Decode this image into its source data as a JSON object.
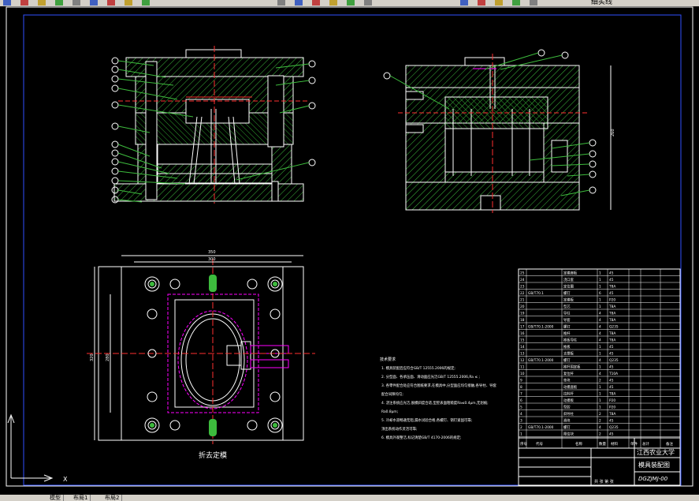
{
  "toolbar": {
    "layer_label": "细实线",
    "icons": [
      "open-icon",
      "save-icon",
      "print-icon",
      "preview-icon",
      "plot-icon",
      "cut-icon",
      "copy-icon",
      "paste-icon",
      "match-icon",
      "undo-icon",
      "redo-icon",
      "pan-icon",
      "zoom-realtime-icon",
      "zoom-window-icon",
      "zoom-previous-icon",
      "properties-icon",
      "design-center-icon",
      "tool-palette-icon",
      "layer-icon",
      "color-icon"
    ]
  },
  "statusbar": {
    "tabs": [
      "模型",
      "布局1",
      "布局2"
    ]
  },
  "drawing": {
    "view_label": "折去定模",
    "notes_title": "技术要求",
    "notes": [
      "1. 模具装配后应符合GB/T 12555.2006的规定;",
      "2. 分型面、各承压面、滑动面应光洁GB/T 12555.2006,Ra ≤ ;",
      "3. 各零件配合处应符合图纸要求,在模具中,分型面应均匀接触,各导柱、导套",
      "   配合间隙均匀;",
      "4. 浇注系统应光洁,脱模斜度合适,型腔表面粗糙度Ra≤0.4μm,无划痕;",
      "   Ra0.8μm;",
      "5. 冷却水道畅通无阻,漏水试验合格,各螺钉、销钉紧固可靠;",
      "   顶出系统动作灵活可靠;",
      "6. 模具外观整洁,标记清楚GB/T 4170-2006的规定;"
    ],
    "title_block": {
      "school": "江西农业大学",
      "drawing_name": "模具装配图",
      "drawing_no": "DGZJMJ-00",
      "sheet": "共 张 第 张"
    },
    "bom_header": [
      "序号",
      "代号",
      "名称",
      "数量",
      "材料",
      "单件",
      "总计",
      "备注"
    ],
    "bom_rows": [
      [
        "25",
        "",
        "定模座板",
        "1",
        "45",
        ""
      ],
      [
        "24",
        "",
        "浇口套",
        "1",
        "45",
        ""
      ],
      [
        "23",
        "",
        "定位圈",
        "1",
        "T8A",
        ""
      ],
      [
        "22",
        "GB/T70.1",
        "螺钉",
        "6",
        "45",
        ""
      ],
      [
        "21",
        "",
        "定模板",
        "1",
        "P20",
        ""
      ],
      [
        "20",
        "",
        "型芯",
        "1",
        "T8A",
        ""
      ],
      [
        "19",
        "",
        "导柱",
        "4",
        "T8A",
        ""
      ],
      [
        "18",
        "",
        "导套",
        "4",
        "T8A",
        ""
      ],
      [
        "17",
        "GB/T70.1-2000",
        "螺钉",
        "4",
        "Q235",
        ""
      ],
      [
        "16",
        "",
        "推杆",
        "4",
        "T8A",
        ""
      ],
      [
        "15",
        "",
        "推板导柱",
        "4",
        "T8A",
        ""
      ],
      [
        "14",
        "",
        "推板",
        "1",
        "45",
        ""
      ],
      [
        "13",
        "",
        "支撑板",
        "1",
        "45",
        ""
      ],
      [
        "12",
        "GB/T70.1-2000",
        "螺钉",
        "4",
        "Q235",
        ""
      ],
      [
        "11",
        "",
        "推杆固定板",
        "1",
        "45",
        ""
      ],
      [
        "10",
        "",
        "复位杆",
        "4",
        "T10A",
        ""
      ],
      [
        "9",
        "",
        "垫块",
        "2",
        "45",
        ""
      ],
      [
        "8",
        "",
        "动模座板",
        "1",
        "45",
        ""
      ],
      [
        "7",
        "",
        "拉料杆",
        "1",
        "T8A",
        ""
      ],
      [
        "6",
        "",
        "动模板",
        "1",
        "P20",
        ""
      ],
      [
        "5",
        "",
        "型腔",
        "1",
        "P20",
        ""
      ],
      [
        "4",
        "",
        "斜导柱",
        "2",
        "T8A",
        ""
      ],
      [
        "3",
        "",
        "滑块",
        "2",
        "45",
        ""
      ],
      [
        "2",
        "GB/T70.1-2000",
        "螺钉",
        "4",
        "Q235",
        ""
      ],
      [
        "1",
        "",
        "限位块",
        "2",
        "45",
        ""
      ]
    ],
    "dimensions": {
      "plan_width": "350",
      "plan_width_inner": "300",
      "plan_height": "320",
      "plan_height_inner": "280",
      "side_height": "260"
    }
  },
  "colors": {
    "background": "#000000",
    "line_white": "#ffffff",
    "hatch_green": "#3dbb3d",
    "cyan": "#00ffff",
    "magenta": "#ff00ff",
    "red": "#ff3030",
    "yellow": "#ffff00",
    "blue_frame": "#3050ff"
  }
}
